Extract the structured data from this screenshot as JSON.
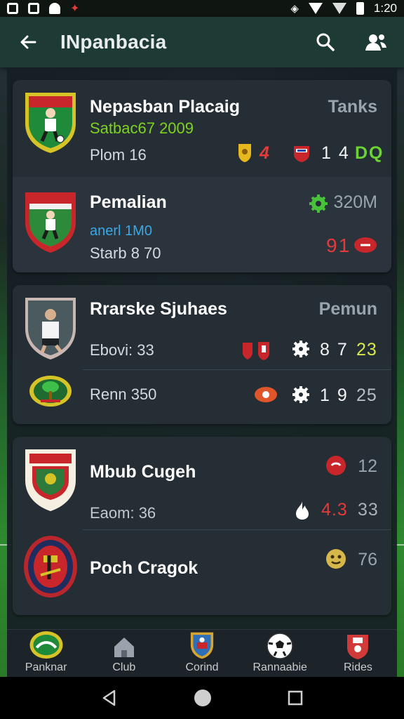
{
  "status_bar": {
    "time": "1:20"
  },
  "app_bar": {
    "title": "INpanbacia",
    "icons": [
      "back-arrow-icon",
      "search-icon",
      "people-icon"
    ]
  },
  "cards": [
    {
      "rows": [
        {
          "name": "Nepasban Placaig",
          "highlight": "Satbac67 2009",
          "sub": "Plom 16",
          "tag": "Tanks",
          "stat1": "1 4",
          "stat2": "DQ",
          "stat_pre": "4"
        },
        {
          "name": "Pemalian",
          "highlight": "anerl 1M0",
          "sub": "Starb 8 70",
          "tag": "320M",
          "stat1": "91"
        }
      ]
    },
    {
      "rows": [
        {
          "name": "Rrarske Sjuhaes",
          "sub": "Ebovi: 33",
          "tag": "Pemun",
          "stat1": "8 7",
          "stat2": "23"
        },
        {
          "sub": "Renn 350",
          "stat1": "1 9",
          "stat2": "25"
        }
      ]
    },
    {
      "rows": [
        {
          "name": "Mbub Cugeh",
          "sub": "Eaom: 36",
          "tag": "12",
          "stat1": "4.3",
          "stat2": "33"
        },
        {
          "name": "Poch Cragok",
          "tag": "76"
        }
      ]
    }
  ],
  "bottom_nav": [
    {
      "label": "Panknar",
      "icon": "crest-icon"
    },
    {
      "label": "Club",
      "icon": "home-icon"
    },
    {
      "label": "Corind",
      "icon": "shield-icon"
    },
    {
      "label": "Rannaabie",
      "icon": "soccer-ball-icon"
    },
    {
      "label": "Rides",
      "icon": "jersey-icon"
    }
  ],
  "colors": {
    "accent_green": "#7ed321",
    "appbar": "#1d3a34",
    "red": "#e23b3b"
  }
}
